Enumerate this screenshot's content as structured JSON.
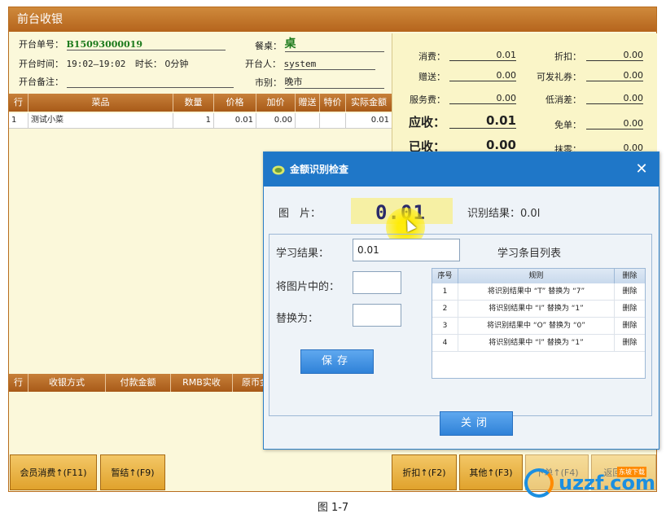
{
  "window": {
    "title": "前台收银"
  },
  "order": {
    "no_label": "开台单号：",
    "no_value": "B15093000019",
    "table_label": "餐桌：",
    "table_value": "桌",
    "time_label": "开台时间：",
    "time_value": "19:02—19:02",
    "duration_label": "时长：",
    "duration_value": "0分钟",
    "opener_label": "开台人：",
    "opener_value": "system",
    "note_label": "开台备注：",
    "note_value": "",
    "market_label": "市别：",
    "market_value": "晚市"
  },
  "summary": {
    "consume_label": "消费：",
    "consume_value": "0.01",
    "discount_label": "折扣：",
    "discount_value": "0.00",
    "gift_label": "赠送：",
    "gift_value": "0.00",
    "coupon_label": "可发礼券：",
    "coupon_value": "0.00",
    "service_label": "服务费：",
    "service_value": "0.00",
    "min_label": "低消差：",
    "min_value": "0.00",
    "due_label": "应收：",
    "due_value": "0.01",
    "free_label": "免单：",
    "free_value": "0.00",
    "paid_label": "已收：",
    "paid_value": "0.00",
    "round_label": "抹零：",
    "round_value": "0.00"
  },
  "dish_grid": {
    "headers": [
      "行",
      "菜品",
      "数量",
      "价格",
      "加价",
      "赠送",
      "特价",
      "实际金额"
    ],
    "rows": [
      {
        "row": "1",
        "name": "测试小菜",
        "qty": "1",
        "price": "0.01",
        "extra": "0.00",
        "gift": "",
        "special": "",
        "amount": "0.01"
      }
    ]
  },
  "payment_grid": {
    "headers": [
      "行",
      "收银方式",
      "付款金额",
      "RMB实收",
      "原币金"
    ]
  },
  "bottom_buttons": {
    "member": "会员消费↑(F11)",
    "temp": "暂结↑(F9)",
    "discount": "折扣↑(F2)",
    "other": "其他↑(F3)",
    "b5": "下单↑(F4)",
    "b6": "返回(Esc)"
  },
  "dialog": {
    "title": "金额识别检查",
    "close": "✕",
    "image_label": "图　片：",
    "image_text": "0.01",
    "result_label": "识别结果：",
    "result_value": "0.0l",
    "learn_label": "学习结果：",
    "learn_value": "0.01",
    "replace_from_label": "将图片中的：",
    "replace_from_value": "",
    "replace_to_label": "替换为：",
    "replace_to_value": "",
    "save_button": "保存",
    "list_title": "学习条目列表",
    "table_headers": [
      "序号",
      "规则",
      "删除"
    ],
    "rules": [
      {
        "no": "1",
        "rule": "将识别结果中 “T” 替换为 “7”",
        "del": "删除"
      },
      {
        "no": "2",
        "rule": "将识别结果中 “I” 替换为 “1”",
        "del": "删除"
      },
      {
        "no": "3",
        "rule": "将识别结果中 “O” 替换为 “0”",
        "del": "删除"
      },
      {
        "no": "4",
        "rule": "将识别结果中 “l” 替换为 “1”",
        "del": "删除"
      }
    ],
    "close_button": "关闭"
  },
  "watermark": {
    "text": "uzzf.com",
    "sub": "东坡下载"
  },
  "caption": "图 1-7"
}
